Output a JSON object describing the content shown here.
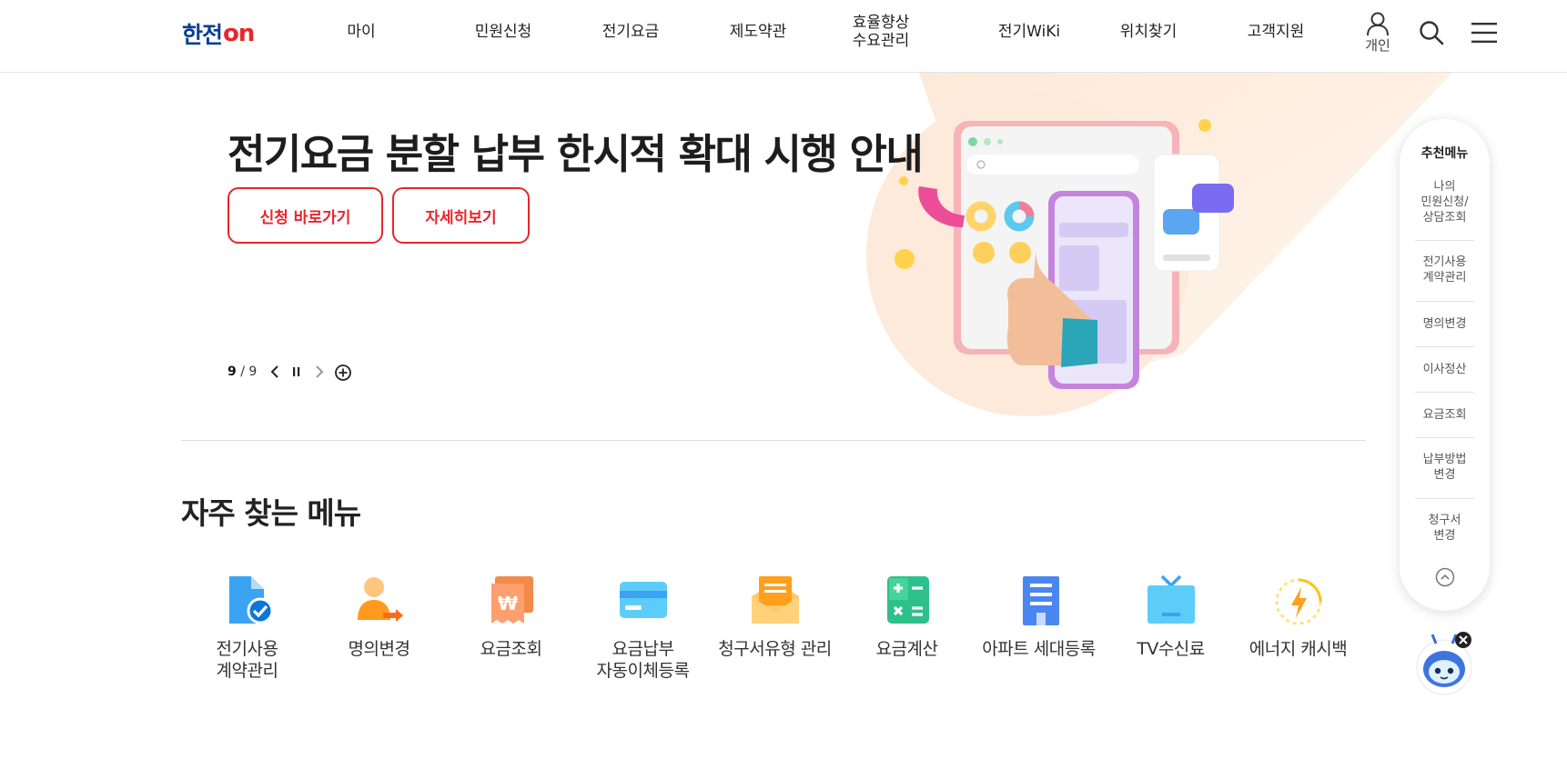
{
  "header": {
    "logo_main": "한전",
    "logo_on": "on",
    "nav": [
      "마이",
      "민원신청",
      "전기요금",
      "제도약관",
      "효율향상\n수요관리",
      "전기WiKi",
      "위치찾기",
      "고객지원"
    ],
    "user_label": "개인"
  },
  "hero": {
    "title": "전기요금 분할 납부 한시적 확대 시행 안내",
    "btn_apply": "신청 바로가기",
    "btn_detail": "자세히보기",
    "slide_current": "9",
    "slide_total": "9"
  },
  "frequent": {
    "title": "자주 찾는 메뉴",
    "items": [
      {
        "label": "전기사용\n계약관리",
        "icon": "document-check-icon"
      },
      {
        "label": "명의변경",
        "icon": "person-transfer-icon"
      },
      {
        "label": "요금조회",
        "icon": "won-receipt-icon"
      },
      {
        "label": "요금납부\n자동이체등록",
        "icon": "credit-card-icon"
      },
      {
        "label": "청구서유형 관리",
        "icon": "envelope-icon"
      },
      {
        "label": "요금계산",
        "icon": "calculator-icon"
      },
      {
        "label": "아파트 세대등록",
        "icon": "building-icon"
      },
      {
        "label": "TV수신료",
        "icon": "tv-icon"
      },
      {
        "label": "에너지 캐시백",
        "icon": "energy-bolt-icon"
      }
    ]
  },
  "quick_menu": {
    "title": "추천메뉴",
    "items": [
      "나의\n민원신청/\n상담조회",
      "전기사용\n계약관리",
      "명의변경",
      "이사정산",
      "요금조회",
      "납부방법\n변경",
      "청구서\n변경"
    ]
  },
  "colors": {
    "brand_blue": "#0a3d91",
    "brand_red": "#e8262c",
    "hero_bg": "#fdf1e7"
  }
}
